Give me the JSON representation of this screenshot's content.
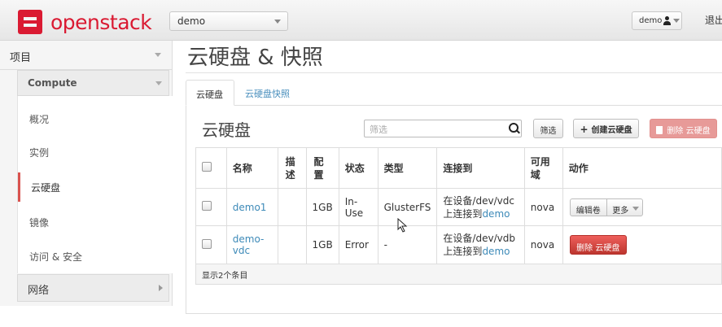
{
  "header": {
    "logo_text": "openstack",
    "project": "demo",
    "user": "demo",
    "logout": "退出"
  },
  "sidebar": {
    "project_label": "项目",
    "compute_label": "Compute",
    "items": [
      {
        "label": "概况",
        "active": false
      },
      {
        "label": "实例",
        "active": false
      },
      {
        "label": "云硬盘",
        "active": true
      },
      {
        "label": "镜像",
        "active": false
      },
      {
        "label": "访问 & 安全",
        "active": false
      }
    ],
    "network_label": "网络"
  },
  "main": {
    "page_title": "云硬盘 & 快照",
    "tabs": [
      {
        "label": "云硬盘",
        "active": true
      },
      {
        "label": "云硬盘快照",
        "active": false
      }
    ],
    "section_title": "云硬盘",
    "filter_placeholder": "筛选",
    "filter_button": "筛选",
    "create_button": "创建云硬盘",
    "delete_button": "删除 云硬盘"
  },
  "table": {
    "columns": [
      "名称",
      "描述",
      "配置",
      "状态",
      "类型",
      "连接到",
      "可用域",
      "动作"
    ],
    "rows": [
      {
        "name": "demo1",
        "description": "",
        "size": "1GB",
        "status": "In-Use",
        "type": "GlusterFS",
        "attached_prefix": "在设备/dev/vdc上连接到",
        "attached_link": "demo",
        "zone": "nova",
        "actions": {
          "edit": "编辑卷",
          "more": "更多"
        }
      },
      {
        "name": "demo-vdc",
        "description": "",
        "size": "1GB",
        "status": "Error",
        "type": "-",
        "attached_prefix": "在设备/dev/vdb上连接到",
        "attached_link": "demo",
        "zone": "nova",
        "actions": {
          "delete": "删除 云硬盘"
        }
      }
    ],
    "footer": "显示2个条目"
  },
  "colors": {
    "brand": "#da1a32",
    "link": "#3d8ab8",
    "danger": "#da4f49",
    "active_marker": "#d9534f"
  }
}
